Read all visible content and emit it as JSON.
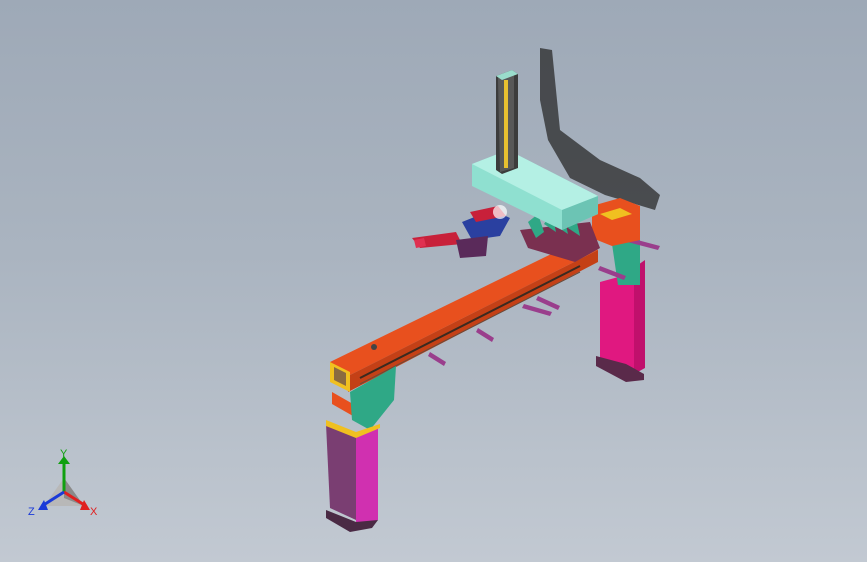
{
  "viewport": {
    "background_top": "#9ea9b7",
    "background_bottom": "#c2c9d2"
  },
  "triad": {
    "x_label": "X",
    "y_label": "Y",
    "z_label": "Z",
    "x_color": "#e02020",
    "y_color": "#10a010",
    "z_color": "#1a3ad8"
  },
  "model": {
    "colors": {
      "beam_top": "#e8501e",
      "beam_side": "#c44016",
      "leg_left": "#7a3e72",
      "leg_left_side": "#d030b0",
      "leg_right": "#e01880",
      "bracket_teal": "#2fa886",
      "carriage": "#8fe0d0",
      "column": "#3c3c3c",
      "yellow_frame": "#f0c020",
      "gripper": "#c8203a",
      "shadow": "#2a2a2a"
    }
  }
}
